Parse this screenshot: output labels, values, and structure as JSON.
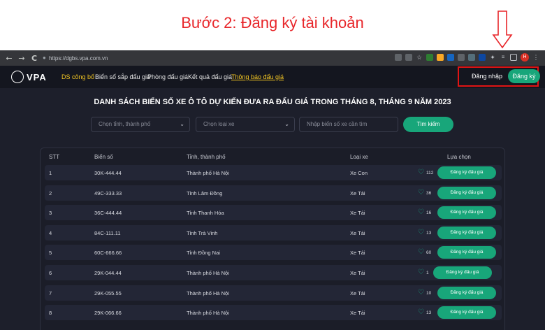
{
  "caption": "Bước 2: Đăng ký tài khoản",
  "browser": {
    "url": "https://dgbs.vpa.com.vn",
    "back": "←",
    "forward": "→",
    "reload": "C",
    "profile_initial": "H"
  },
  "site": {
    "logo_text": "VPA",
    "nav": [
      "DS công bố",
      "Biển số sắp đấu giá",
      "Phòng đấu giá",
      "Kết quả đấu giá",
      "Thông báo đấu giá"
    ],
    "login": "Đăng nhập",
    "signup": "Đăng ký"
  },
  "title": "DANH SÁCH BIỂN SỐ XE Ô TÔ DỰ KIẾN ĐƯA RA ĐẤU GIÁ TRONG THÁNG 8, THÁNG 9 NĂM 2023",
  "filters": {
    "province_placeholder": "Chọn tỉnh, thành phố",
    "type_placeholder": "Chọn loại xe",
    "search_placeholder": "Nhập biển số xe cần tìm",
    "search_button": "Tìm kiếm"
  },
  "table": {
    "headers": [
      "STT",
      "Biển số",
      "Tỉnh, thành phố",
      "Loại xe",
      "Lựa chọn"
    ],
    "register_label": "Đăng ký đấu giá",
    "rows": [
      {
        "stt": "1",
        "plate": "30K-444.44",
        "province": "Thành phố Hà Nội",
        "type": "Xe Con",
        "likes": "112"
      },
      {
        "stt": "2",
        "plate": "49C-333.33",
        "province": "Tỉnh Lâm Đồng",
        "type": "Xe Tải",
        "likes": "36"
      },
      {
        "stt": "3",
        "plate": "36C-444.44",
        "province": "Tỉnh Thanh Hóa",
        "type": "Xe Tải",
        "likes": "16"
      },
      {
        "stt": "4",
        "plate": "84C-111.11",
        "province": "Tỉnh Trà Vinh",
        "type": "Xe Tải",
        "likes": "13"
      },
      {
        "stt": "5",
        "plate": "60C-666.66",
        "province": "Tỉnh Đồng Nai",
        "type": "Xe Tải",
        "likes": "60"
      },
      {
        "stt": "6",
        "plate": "29K-044.44",
        "province": "Thành phố Hà Nội",
        "type": "Xe Tải",
        "likes": "1"
      },
      {
        "stt": "7",
        "plate": "29K-055.55",
        "province": "Thành phố Hà Nội",
        "type": "Xe Tải",
        "likes": "10"
      },
      {
        "stt": "8",
        "plate": "29K-066.66",
        "province": "Thành phố Hà Nội",
        "type": "Xe Tải",
        "likes": "13"
      }
    ]
  },
  "colors": {
    "accent": "#18a67a",
    "highlight": "#f3c623",
    "annotation": "#e01414",
    "background": "#1d1f2b"
  }
}
